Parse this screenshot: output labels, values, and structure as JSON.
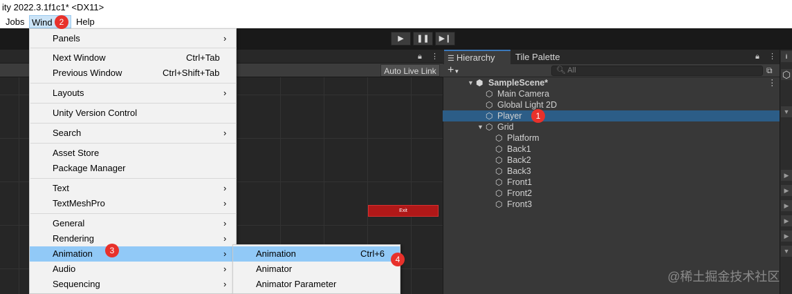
{
  "title_bar": {
    "text": "ity 2022.3.1f1c1* <DX11>"
  },
  "menubar": {
    "items": [
      "Jobs",
      "Wind",
      "Help"
    ]
  },
  "play_controls": {
    "play": "▶",
    "pause": "❚❚",
    "step": "▶❙"
  },
  "left_panel": {
    "auto_live_link": "Auto Live Link",
    "exit_button": "Exit"
  },
  "hierarchy": {
    "tabs": [
      "Hierarchy",
      "Tile Palette"
    ],
    "search_placeholder": "All",
    "scene": "SampleScene*",
    "items": [
      "Main Camera",
      "Global Light 2D",
      "Player",
      "Grid",
      "Platform",
      "Back1",
      "Back2",
      "Back3",
      "Front1",
      "Front2",
      "Front3"
    ]
  },
  "window_menu": {
    "items": [
      {
        "label": "Panels",
        "shortcut": "",
        "submenu": true
      },
      {
        "label": "Next Window",
        "shortcut": "Ctrl+Tab",
        "submenu": false
      },
      {
        "label": "Previous Window",
        "shortcut": "Ctrl+Shift+Tab",
        "submenu": false
      },
      {
        "label": "Layouts",
        "shortcut": "",
        "submenu": true
      },
      {
        "label": "Unity Version Control",
        "shortcut": "",
        "submenu": false
      },
      {
        "label": "Search",
        "shortcut": "",
        "submenu": true
      },
      {
        "label": "Asset Store",
        "shortcut": "",
        "submenu": false
      },
      {
        "label": "Package Manager",
        "shortcut": "",
        "submenu": false
      },
      {
        "label": "Text",
        "shortcut": "",
        "submenu": true
      },
      {
        "label": "TextMeshPro",
        "shortcut": "",
        "submenu": true
      },
      {
        "label": "General",
        "shortcut": "",
        "submenu": true
      },
      {
        "label": "Rendering",
        "shortcut": "",
        "submenu": true
      },
      {
        "label": "Animation",
        "shortcut": "",
        "submenu": true
      },
      {
        "label": "Audio",
        "shortcut": "",
        "submenu": true
      },
      {
        "label": "Sequencing",
        "shortcut": "",
        "submenu": true
      }
    ]
  },
  "animation_submenu": {
    "items": [
      {
        "label": "Animation",
        "shortcut": "Ctrl+6"
      },
      {
        "label": "Animator",
        "shortcut": ""
      },
      {
        "label": "Animator Parameter",
        "shortcut": ""
      }
    ]
  },
  "badges": [
    "1",
    "2",
    "3",
    "4"
  ],
  "watermark": "@稀土掘金技术社区",
  "colors": {
    "highlight": "#91c9f7",
    "selected_row": "#2c5d87",
    "badge": "#e8312b"
  }
}
